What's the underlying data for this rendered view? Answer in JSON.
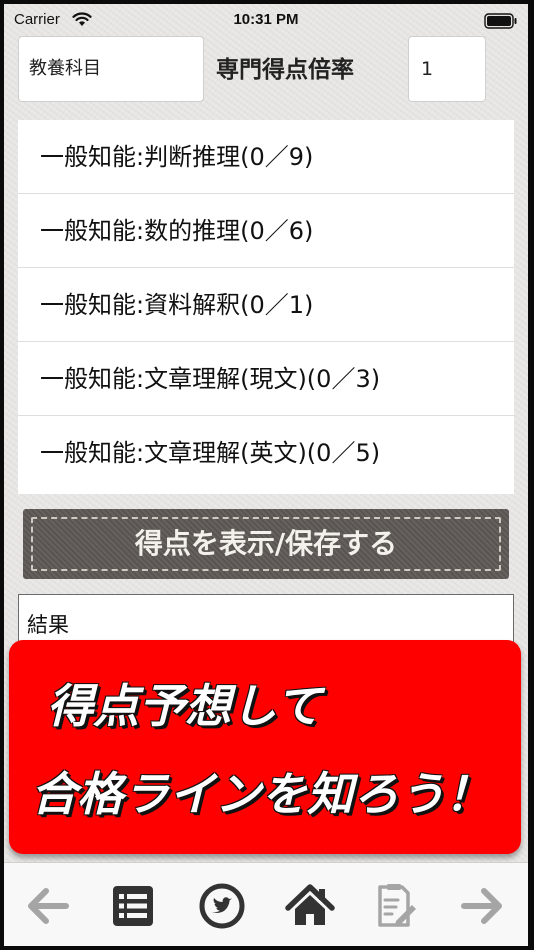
{
  "status_bar": {
    "carrier": "Carrier",
    "time": "10:31 PM"
  },
  "header": {
    "subject": "教養科目",
    "multiplier_label": "専門得点倍率",
    "multiplier_value": "1"
  },
  "categories": [
    {
      "label": "一般知能:判断推理(0／9)"
    },
    {
      "label": "一般知能:数的推理(0／6)"
    },
    {
      "label": "一般知能:資料解釈(0／1)"
    },
    {
      "label": "一般知能:文章理解(現文)(0／3)"
    },
    {
      "label": "一般知能:文章理解(英文)(0／5)"
    }
  ],
  "show_save_button": "得点を表示/保存する",
  "result_label": "結果",
  "promo": {
    "line1": "得点予想して",
    "line2": "合格ラインを知ろう！"
  },
  "toolbar": {
    "icons": [
      "arrow-left-icon",
      "list-icon",
      "twitter-icon",
      "home-icon",
      "memo-icon",
      "arrow-right-icon"
    ]
  },
  "colors": {
    "banner": "#ff0000",
    "button": "#5e5955",
    "toolbar_icon": "#333333",
    "toolbar_icon_inactive": "#a5a5a5"
  }
}
